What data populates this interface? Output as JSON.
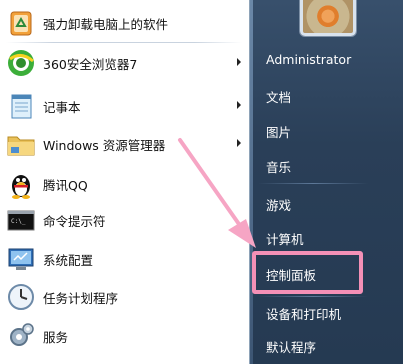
{
  "programs": [
    {
      "label": "强力卸载电脑上的软件",
      "icon": "uninstall-recycle-icon",
      "has_submenu": false
    },
    {
      "label": "360安全浏览器7",
      "icon": "360-browser-icon",
      "has_submenu": true
    },
    {
      "label": "记事本",
      "icon": "notepad-icon",
      "has_submenu": true
    },
    {
      "label": "Windows 资源管理器",
      "icon": "folder-explorer-icon",
      "has_submenu": true
    },
    {
      "label": "腾讯QQ",
      "icon": "qq-penguin-icon",
      "has_submenu": false
    },
    {
      "label": "命令提示符",
      "icon": "command-prompt-icon",
      "has_submenu": false
    },
    {
      "label": "系统配置",
      "icon": "system-config-icon",
      "has_submenu": false
    },
    {
      "label": "任务计划程序",
      "icon": "task-scheduler-clock-icon",
      "has_submenu": false
    },
    {
      "label": "服务",
      "icon": "services-gear-icon",
      "has_submenu": false
    }
  ],
  "right_links": [
    {
      "label": "Administrator"
    },
    {
      "label": "文档"
    },
    {
      "label": "图片"
    },
    {
      "label": "音乐"
    },
    {
      "label": "游戏"
    },
    {
      "label": "计算机"
    },
    {
      "label": "控制面板"
    },
    {
      "label": "设备和打印机"
    },
    {
      "label": "默认程序"
    }
  ],
  "highlight": {
    "target": "控制面板",
    "color": "#f490b6"
  },
  "colors": {
    "right_pane": "#2b3f57",
    "left_pane": "#ffffff",
    "annotation_pink": "#f490b6"
  }
}
